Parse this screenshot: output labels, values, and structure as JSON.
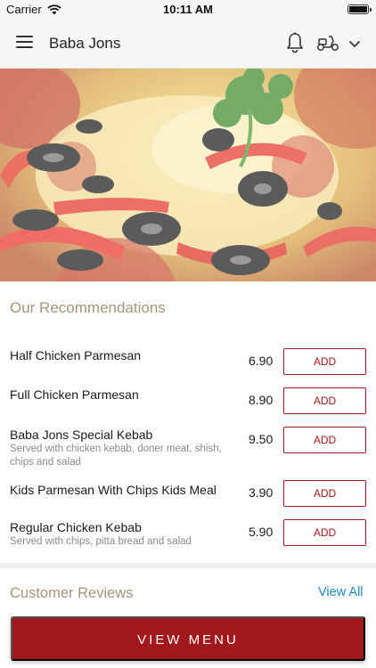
{
  "status_bar": {
    "carrier": "Carrier",
    "time": "10:11 AM"
  },
  "header": {
    "title": "Baba Jons",
    "icons": [
      "menu-icon",
      "bell-icon",
      "scooter-icon",
      "chevron-down-icon"
    ]
  },
  "hero": {
    "image": "pizza-photo"
  },
  "recommendations": {
    "title": "Our Recommendations",
    "add_label": "ADD",
    "items": [
      {
        "name": "Half Chicken Parmesan",
        "description": "",
        "price": "6.90"
      },
      {
        "name": "Full Chicken Parmesan",
        "description": "",
        "price": "8.90"
      },
      {
        "name": "Baba Jons Special Kebab",
        "description": "Served with chicken kebab, doner meat, shish, chips and salad",
        "price": "9.50"
      },
      {
        "name": "Kids Parmesan With Chips Kids Meal",
        "description": "",
        "price": "3.90"
      },
      {
        "name": "Regular Chicken Kebab",
        "description": "Served with chips, pitta bread and salad",
        "price": "5.90"
      }
    ]
  },
  "reviews": {
    "title": "Customer Reviews",
    "view_all": "View All"
  },
  "footer": {
    "button_label": "VIEW MENU"
  },
  "colors": {
    "accent": "#a0171c",
    "section_title": "#a89479",
    "link": "#1e88c9"
  }
}
